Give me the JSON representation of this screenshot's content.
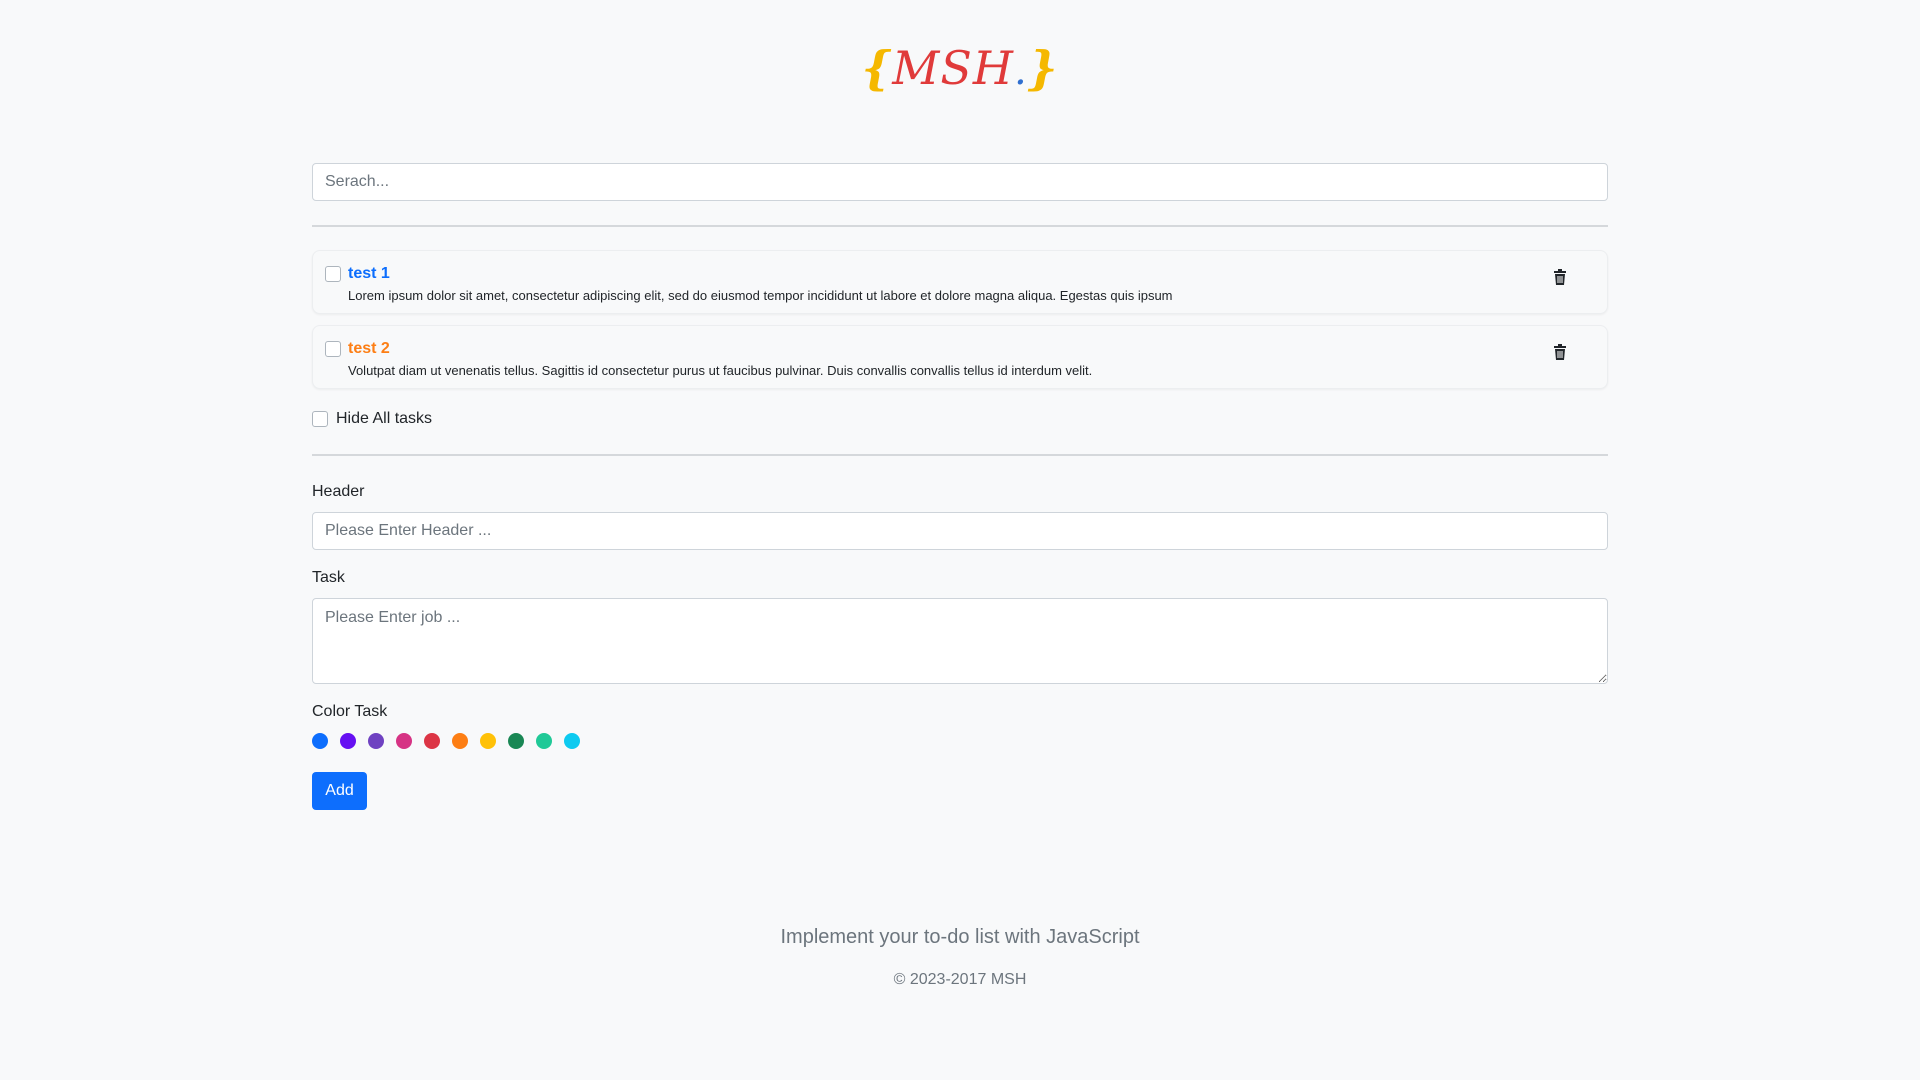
{
  "logo": {
    "open_brace": "{",
    "text": "MSH",
    "dot": ".",
    "close_brace": "}"
  },
  "search": {
    "placeholder": "Serach..."
  },
  "tasks": [
    {
      "title": "test 1",
      "description": "Lorem ipsum dolor sit amet, consectetur adipiscing elit, sed do eiusmod tempor incididunt ut labore et dolore magna aliqua. Egestas quis ipsum",
      "color": "#0d6efd",
      "checked": false,
      "delete_icon": "trash-icon"
    },
    {
      "title": "test 2",
      "description": "Volutpat diam ut venenatis tellus. Sagittis id consectetur purus ut faucibus pulvinar. Duis convallis convallis tellus id interdum velit.",
      "color": "#fd7e14",
      "checked": false,
      "delete_icon": "trash-icon"
    }
  ],
  "hide_all": {
    "label": "Hide All tasks",
    "checked": false
  },
  "form": {
    "header_label": "Header",
    "header_placeholder": "Please Enter Header ...",
    "task_label": "Task",
    "task_placeholder": "Please Enter job ...",
    "color_label": "Color Task",
    "colors": [
      "#0d6efd",
      "#6610f2",
      "#6f42c1",
      "#d63384",
      "#dc3545",
      "#fd7e14",
      "#ffc107",
      "#198754",
      "#20c997",
      "#0dcaf0"
    ],
    "add_button": "Add"
  },
  "footer": {
    "lead": "Implement your to-do list with JavaScript",
    "copyright": "© 2023-2017 MSH"
  }
}
